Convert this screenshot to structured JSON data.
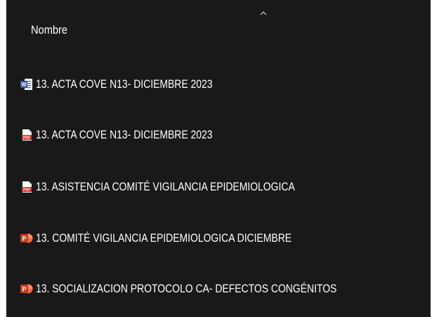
{
  "list": {
    "column_header": "Nombre",
    "sort_icon": "chevron-up-icon",
    "files": [
      {
        "name": "13.  ACTA COVE N13- DICIEMBRE 2023",
        "icon": "word-document-icon",
        "color": "#2b579a"
      },
      {
        "name": "13.  ACTA COVE N13- DICIEMBRE 2023",
        "icon": "pdf-file-icon",
        "color": "#d32f2f"
      },
      {
        "name": "13. ASISTENCIA COMITÉ VIGILANCIA EPIDEMIOLOGICA",
        "icon": "pdf-file-icon",
        "color": "#d32f2f"
      },
      {
        "name": "13. COMITÉ VIGILANCIA EPIDEMIOLOGICA DICIEMBRE",
        "icon": "powerpoint-file-icon",
        "color": "#d04423"
      },
      {
        "name": "13. SOCIALIZACION PROTOCOLO CA- DEFECTOS CONGÉNITOS",
        "icon": "powerpoint-file-icon",
        "color": "#d04423"
      }
    ]
  }
}
